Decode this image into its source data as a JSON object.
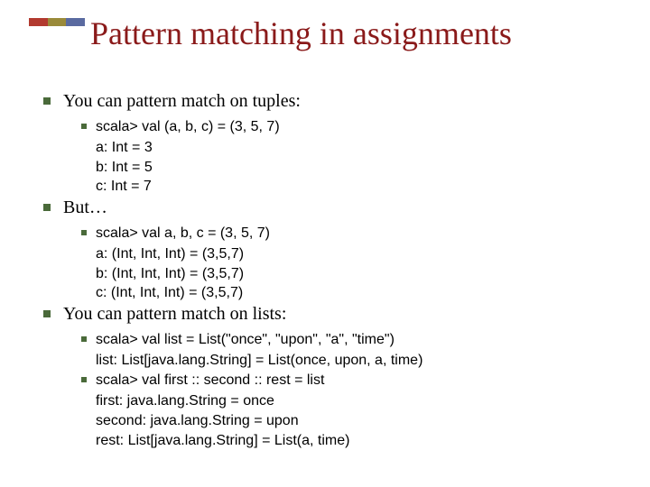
{
  "title": "Pattern matching in assignments",
  "sections": [
    {
      "heading": "You can pattern match on tuples:",
      "items": [
        {
          "lead": "scala> val (a, b, c) = (3, 5, 7)",
          "lines": [
            "a: Int = 3",
            "b: Int = 5",
            "c: Int = 7"
          ]
        }
      ]
    },
    {
      "heading": "But…",
      "items": [
        {
          "lead": "scala> val a, b, c = (3, 5, 7)",
          "lines": [
            "a: (Int, Int, Int) = (3,5,7)",
            "b: (Int, Int, Int) = (3,5,7)",
            "c: (Int, Int, Int) = (3,5,7)"
          ]
        }
      ]
    },
    {
      "heading": "You can pattern match on lists:",
      "items": [
        {
          "lead": "scala> val list = List(\"once\", \"upon\", \"a\", \"time\")",
          "lines": [
            "list: List[java.lang.String] = List(once, upon, a, time)"
          ]
        },
        {
          "lead": "scala> val first :: second :: rest = list",
          "lines": [
            "first: java.lang.String = once",
            "second: java.lang.String = upon",
            "rest: List[java.lang.String] = List(a, time)"
          ]
        }
      ]
    }
  ]
}
